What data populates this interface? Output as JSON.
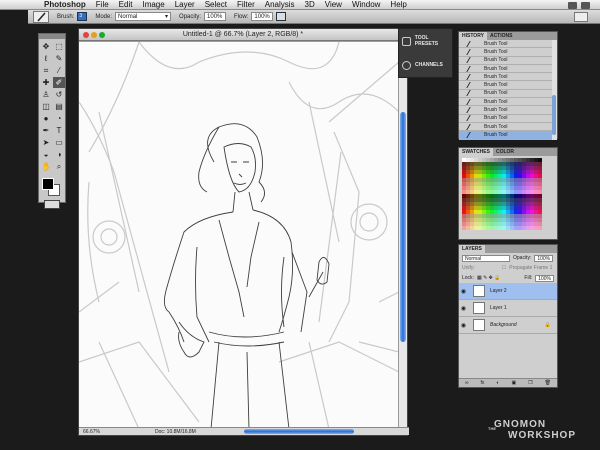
{
  "menubar": {
    "app": "Photoshop",
    "items": [
      "File",
      "Edit",
      "Image",
      "Layer",
      "Select",
      "Filter",
      "Analysis",
      "3D",
      "View",
      "Window",
      "Help"
    ]
  },
  "options": {
    "brush_label": "Brush:",
    "brush_size": "3",
    "mode_label": "Mode:",
    "mode_value": "Normal",
    "opacity_label": "Opacity:",
    "opacity_value": "100%",
    "flow_label": "Flow:",
    "flow_value": "100%"
  },
  "document": {
    "title": "Untitled-1 @ 66.7% (Layer 2, RGB/8) *",
    "zoom": "66.67%",
    "doc_size": "Doc: 10.8M/16.8M"
  },
  "dock": {
    "items": [
      "TOOL PRESETS",
      "CHANNELS"
    ]
  },
  "history": {
    "tabs": [
      "HISTORY",
      "ACTIONS"
    ],
    "items": [
      "Brush Tool",
      "Brush Tool",
      "Brush Tool",
      "Brush Tool",
      "Brush Tool",
      "Brush Tool",
      "Brush Tool",
      "Brush Tool",
      "Brush Tool",
      "Brush Tool",
      "Brush Tool",
      "Brush Tool"
    ]
  },
  "swatches": {
    "tabs": [
      "SWATCHES",
      "COLOR"
    ]
  },
  "layers": {
    "tab": "LAYERS",
    "blend_mode": "Normal",
    "opacity_label": "Opacity:",
    "opacity_value": "100%",
    "unify_label": "Unify:",
    "propagate_label": "Propagate Frame 1",
    "lock_label": "Lock:",
    "fill_label": "Fill:",
    "fill_value": "100%",
    "items": [
      "Layer 2",
      "Layer 1",
      "Background"
    ],
    "footer": [
      "fx",
      "◐",
      "▣",
      "❐",
      "🗑"
    ]
  },
  "logo": {
    "the": "THE",
    "line1": "GNOMON",
    "line2": "WORKSHOP"
  },
  "colors": {
    "selection": "#8fb2e3",
    "scroll_blue": "#2b6ed1"
  }
}
